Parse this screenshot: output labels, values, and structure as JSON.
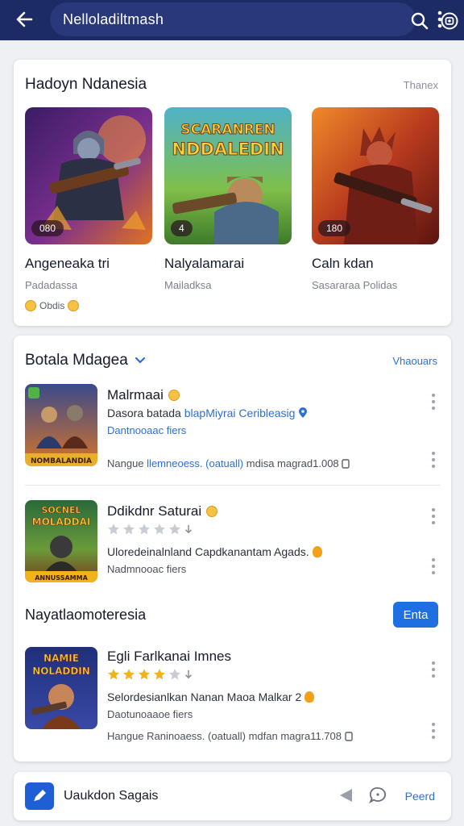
{
  "header": {
    "search_query": "Nelloladiltmash",
    "back_icon": "arrow-left-icon",
    "search_icon": "search-icon",
    "lens_icon": "lens-icon",
    "more_icon": "more-vertical-icon"
  },
  "featured": {
    "title": "Hadoyn Ndanesia",
    "more_link": "Thanex",
    "tiles": [
      {
        "name": "Angeneaka tri",
        "developer": "Padadassa",
        "badge": "080"
      },
      {
        "name": "Nalyalamarai",
        "developer": "Mailadksa",
        "badge": "4",
        "art_title": "SCARANREN\nNDDALEDIN"
      },
      {
        "name": "Caln kdan",
        "developer": "Sasararaa Polidas",
        "badge": "180"
      }
    ],
    "rating_text": "Obdis"
  },
  "list_section": {
    "title": "Botala Mdagea",
    "more_link": "Vhaouars",
    "apps": [
      {
        "title": "Malrmaai",
        "line1_prefix": "Dasora batada",
        "line1_link": "blapMiyrai Ceribleasig",
        "line2": "Dantnooaac fiers",
        "meta_prefix": "Nangue",
        "meta_link": "llemneoess. (oatuall)",
        "meta_suffix": "mdisa magrad1.008",
        "thumb_caption": "NOMBALANDIA"
      },
      {
        "title": "Ddikdnr Saturai",
        "rating": 0,
        "line1": "Uloredeinalnland Capdkanantam Agads.",
        "line2": "Nadmnooac fiers",
        "thumb_title": "SOCNEL\nMOLADDAI",
        "thumb_caption": "ANNUSSAMMA"
      }
    ],
    "subsection_title": "Nayatlaomoteresia",
    "subsection_button": "Enta",
    "featured_app": {
      "title": "Egli Farlkanai Imnes",
      "rating": 4,
      "line1": "Selordesianlkan Nanan Maoa Malkar 2",
      "line2": "Daotunoaaoe fiers",
      "meta": "Hangue Raninoaess. (oatuall) mdfan magra11.708",
      "thumb_title": "NAMIE\nNOLADDIN"
    }
  },
  "bottom_bar": {
    "label": "Uaukdon Sagais",
    "link": "Peerd",
    "app_icon": "pen-icon",
    "triangle_icon": "triangle-left-icon",
    "chat_icon": "chat-icon"
  },
  "colors": {
    "header_bg": "#1d2b64",
    "search_bg": "#28387a",
    "accent_blue": "#1e6fe0",
    "link_blue": "#2e6fd0",
    "star_gold": "#f2b21a"
  }
}
